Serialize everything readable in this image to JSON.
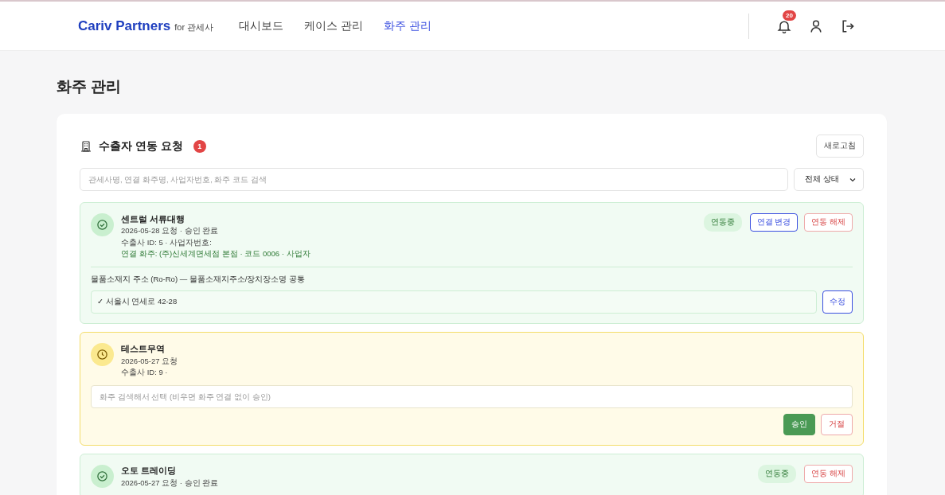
{
  "header": {
    "brand": "Cariv Partners",
    "brand_suffix": "for 관세사",
    "nav": [
      {
        "label": "대시보드",
        "selected": false
      },
      {
        "label": "케이스 관리",
        "selected": false
      },
      {
        "label": "화주 관리",
        "selected": true
      }
    ],
    "notifications": "20"
  },
  "page_title": "화주 관리",
  "panel": {
    "title": "수출자 연동 요청",
    "count": "1",
    "refresh_button": "새로고침",
    "search": {
      "placeholder": "관세사명, 연결 화주명, 사업자번호, 화주 코드 검색"
    },
    "status_filter": "전체 상태",
    "requests": [
      {
        "kind": "approved",
        "name": "센트럴 서류대행",
        "meta": "2026-05-28 요청 · 승인 완료",
        "id_line": "수출사 ID: 5 · 사업자번호:",
        "linked": "연결 화주: (주)신세계면세점 본점 · 코드 0006 · 사업자",
        "badge": "연동중",
        "actions": [
          {
            "kind": "primary",
            "label": "연결 변경"
          },
          {
            "kind": "danger",
            "label": "연동 해제"
          }
        ],
        "address": {
          "label": "물품소재지 주소 (Ro-Ro) — 물품소재지주소/장치장소명 공통",
          "value": "✓ 서울시 연세로 42-28",
          "button": "수정"
        }
      },
      {
        "kind": "pending",
        "name": "테스트무역",
        "meta": "2026-05-27 요청",
        "id_line": "수출사 ID: 9 ·",
        "search": {
          "placeholder": "화주 검색해서 선택 (비우면 화주 연결 없이 승인)"
        },
        "actions": [
          {
            "kind": "approve",
            "label": "승인"
          },
          {
            "kind": "danger",
            "label": "거절"
          }
        ]
      },
      {
        "kind": "approved",
        "name": "오토 트레이딩",
        "meta": "2026-05-27 요청 · 승인 완료",
        "badge": "연동중",
        "actions": [
          {
            "kind": "danger",
            "label": "연동 해제"
          }
        ]
      }
    ]
  }
}
